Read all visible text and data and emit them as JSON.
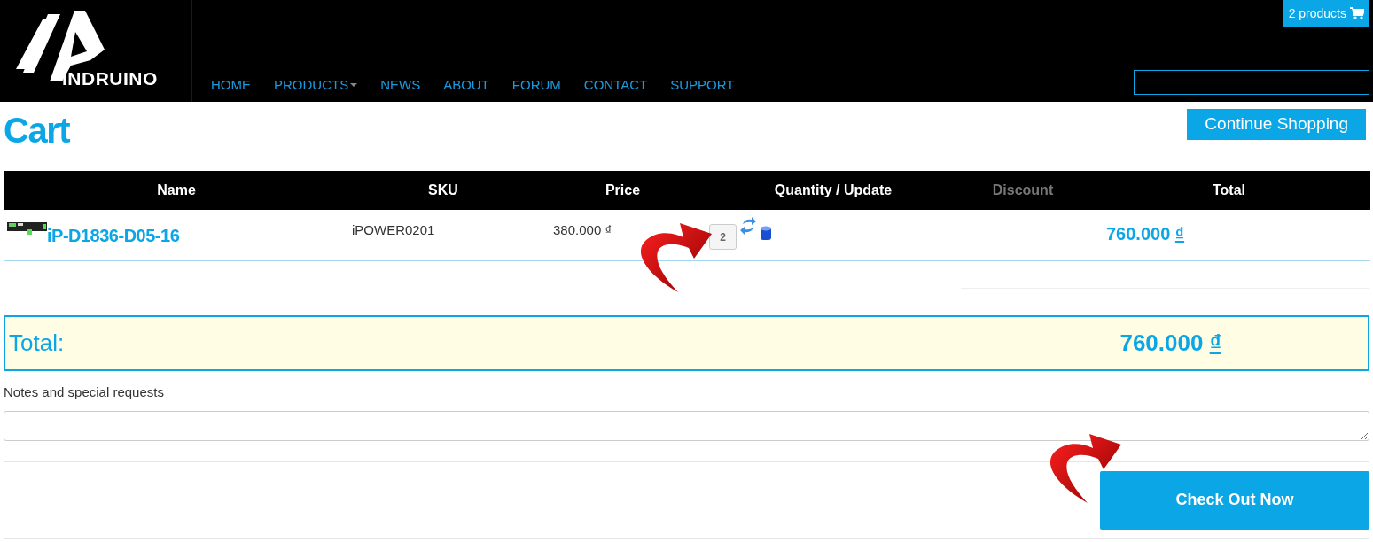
{
  "header": {
    "logo_text": "INDRUINO",
    "nav": [
      {
        "label": "HOME",
        "dropdown": false
      },
      {
        "label": "PRODUCTS",
        "dropdown": true
      },
      {
        "label": "NEWS",
        "dropdown": false
      },
      {
        "label": "ABOUT",
        "dropdown": false
      },
      {
        "label": "FORUM",
        "dropdown": false
      },
      {
        "label": "CONTACT",
        "dropdown": false
      },
      {
        "label": "SUPPORT",
        "dropdown": false
      }
    ],
    "cart_badge": "2 products"
  },
  "page_title": "Cart",
  "continue_button": "Continue Shopping",
  "table": {
    "columns": [
      {
        "label": "Name",
        "muted": false
      },
      {
        "label": "SKU",
        "muted": false
      },
      {
        "label": "Price",
        "muted": false
      },
      {
        "label": "Quantity / Update",
        "muted": false
      },
      {
        "label": "Discount",
        "muted": true
      },
      {
        "label": "Total",
        "muted": false
      }
    ],
    "rows": [
      {
        "name": "iP-D1836-D05-16",
        "sku": "iPOWER0201",
        "price": "380.000",
        "price_currency": "₫",
        "quantity": "2",
        "total": "760.000",
        "total_currency": "₫"
      }
    ]
  },
  "summary": {
    "label": "Total:",
    "amount": "760.000",
    "currency": "₫"
  },
  "notes": {
    "label": "Notes and special requests"
  },
  "checkout_button": "Check Out Now"
}
